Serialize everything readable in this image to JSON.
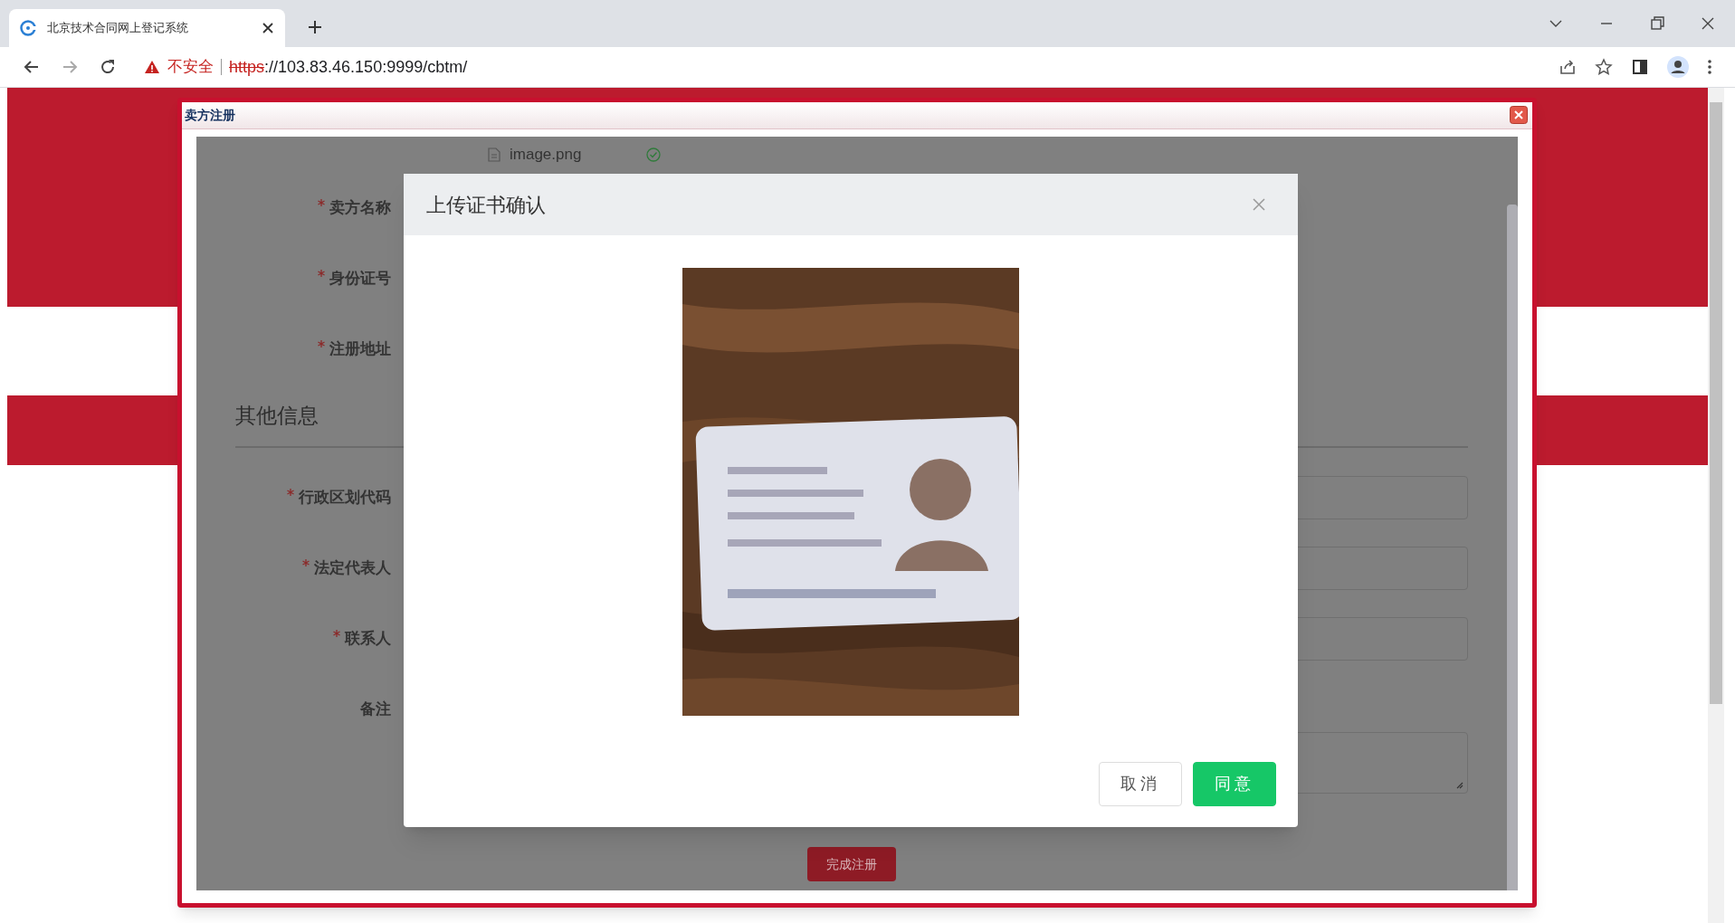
{
  "browser": {
    "tab": {
      "title": "北京技术合同网上登记系统",
      "selected": true
    },
    "address": {
      "security": "不安全",
      "scheme": "https",
      "rest": "://103.83.46.150:9999/cbtm/"
    }
  },
  "window": {
    "title": "卖方注册"
  },
  "upload": {
    "file": "image.png"
  },
  "sections": [
    {
      "fields": [
        {
          "label": "卖方名称",
          "required": true,
          "kind": "plain"
        },
        {
          "label": "身份证号",
          "required": true,
          "kind": "plain"
        },
        {
          "label": "注册地址",
          "required": true,
          "kind": "plain"
        }
      ]
    },
    {
      "heading": "其他信息",
      "fields": [
        {
          "label": "行政区划代码",
          "required": true,
          "kind": "input"
        },
        {
          "label": "法定代表人",
          "required": true,
          "kind": "input"
        },
        {
          "label": "联系人",
          "required": true,
          "kind": "input"
        },
        {
          "label": "备注",
          "required": false,
          "kind": "textarea"
        }
      ]
    }
  ],
  "submit": "完成注册",
  "modal": {
    "title": "上传证书确认",
    "buttons": [
      {
        "label": "取消",
        "kind": "secondary"
      },
      {
        "label": "同意",
        "kind": "primary"
      }
    ]
  }
}
